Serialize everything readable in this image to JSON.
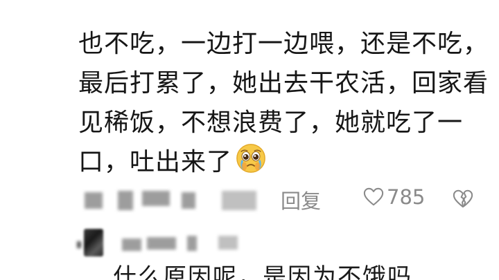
{
  "comment": {
    "lines": [
      "也不吃，一边打一边喂，还是不吃，",
      "最后打累了，她出去干农活，回家看",
      "见稀饭，不想浪费了，她就吃了一",
      "口，吐出来了"
    ],
    "emoji": "crying-pleading-face"
  },
  "meta": {
    "reply_label": "回复",
    "like_count": "785"
  },
  "reply": {
    "text": "什么原因呢，是因为不饿吗"
  },
  "colors": {
    "text": "#161616",
    "meta": "#8a8a8a",
    "emoji_face": "#f7c948"
  }
}
